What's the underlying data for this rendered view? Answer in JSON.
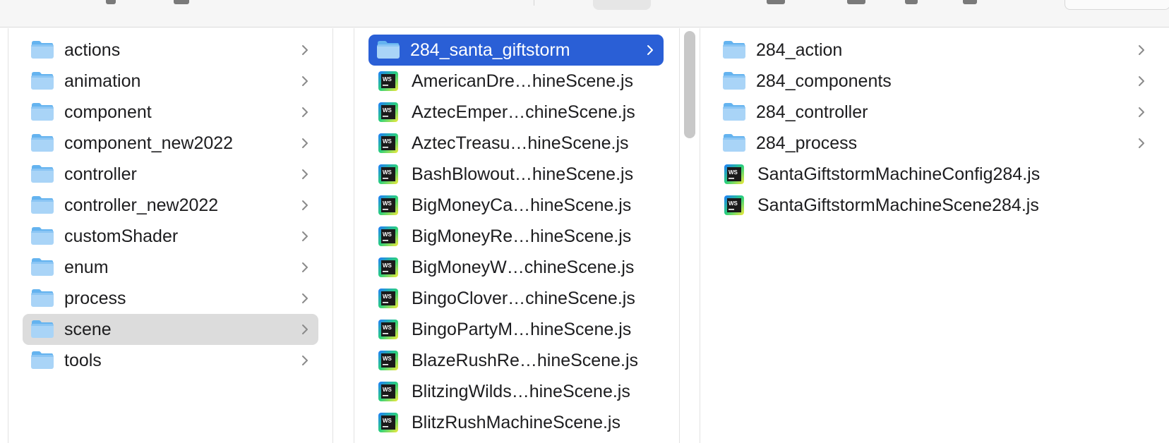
{
  "colors": {
    "selection_blue": "#2a5fd6",
    "selection_grey": "#dcdcdc",
    "folder_light": "#a9d4f7",
    "folder_dark": "#64b3ef",
    "ws_dark": "#1a1a1a"
  },
  "columns": [
    {
      "name": "col-src",
      "items": [
        {
          "label": "actions",
          "type": "folder",
          "selected": false
        },
        {
          "label": "animation",
          "type": "folder",
          "selected": false
        },
        {
          "label": "component",
          "type": "folder",
          "selected": false
        },
        {
          "label": "component_new2022",
          "type": "folder",
          "selected": false
        },
        {
          "label": "controller",
          "type": "folder",
          "selected": false
        },
        {
          "label": "controller_new2022",
          "type": "folder",
          "selected": false
        },
        {
          "label": "customShader",
          "type": "folder",
          "selected": false
        },
        {
          "label": "enum",
          "type": "folder",
          "selected": false
        },
        {
          "label": "process",
          "type": "folder",
          "selected": false
        },
        {
          "label": "scene",
          "type": "folder",
          "selected": "grey"
        },
        {
          "label": "tools",
          "type": "folder",
          "selected": false
        }
      ]
    },
    {
      "name": "col-scene",
      "items": [
        {
          "label": "284_santa_giftstorm",
          "type": "folder",
          "selected": "blue"
        },
        {
          "label": "AmericanDre…hineScene.js",
          "type": "file",
          "selected": false
        },
        {
          "label": "AztecEmper…chineScene.js",
          "type": "file",
          "selected": false
        },
        {
          "label": "AztecTreasu…hineScene.js",
          "type": "file",
          "selected": false
        },
        {
          "label": "BashBlowout…hineScene.js",
          "type": "file",
          "selected": false
        },
        {
          "label": "BigMoneyCa…hineScene.js",
          "type": "file",
          "selected": false
        },
        {
          "label": "BigMoneyRe…hineScene.js",
          "type": "file",
          "selected": false
        },
        {
          "label": "BigMoneyW…chineScene.js",
          "type": "file",
          "selected": false
        },
        {
          "label": "BingoClover…chineScene.js",
          "type": "file",
          "selected": false
        },
        {
          "label": "BingoPartyM…hineScene.js",
          "type": "file",
          "selected": false
        },
        {
          "label": "BlazeRushRe…hineScene.js",
          "type": "file",
          "selected": false
        },
        {
          "label": "BlitzingWilds…hineScene.js",
          "type": "file",
          "selected": false
        },
        {
          "label": "BlitzRushMachineScene.js",
          "type": "file",
          "selected": false
        }
      ]
    },
    {
      "name": "col-giftstorm",
      "items": [
        {
          "label": "284_action",
          "type": "folder",
          "selected": false
        },
        {
          "label": "284_components",
          "type": "folder",
          "selected": false
        },
        {
          "label": "284_controller",
          "type": "folder",
          "selected": false
        },
        {
          "label": "284_process",
          "type": "folder",
          "selected": false
        },
        {
          "label": "SantaGiftstormMachineConfig284.js",
          "type": "file",
          "selected": false
        },
        {
          "label": "SantaGiftstormMachineScene284.js",
          "type": "file",
          "selected": false
        }
      ]
    }
  ]
}
